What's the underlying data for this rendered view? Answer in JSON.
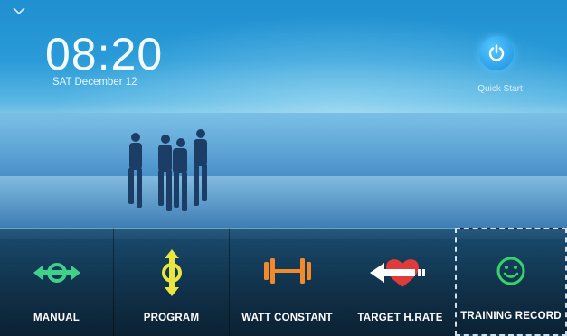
{
  "clock": {
    "time": "08:20",
    "date": "SAT December 12"
  },
  "quick_start": {
    "label": "Quick Start"
  },
  "tiles": [
    {
      "label": "MANUAL",
      "color": "#3fd08a"
    },
    {
      "label": "PROGRAM",
      "color": "#e9e642"
    },
    {
      "label": "WATT CONSTANT",
      "color": "#f08a2a"
    },
    {
      "label": "TARGET H.RATE",
      "color": "#e03b3b"
    },
    {
      "label": "TRAINING RECORD",
      "color": "#36d36b"
    }
  ],
  "icons": [
    "collapse-chevron",
    "power-icon",
    "manual-icon",
    "program-icon",
    "dumbbell-icon",
    "heart-icon",
    "smiley-icon"
  ],
  "accent": "#1a8fe0"
}
